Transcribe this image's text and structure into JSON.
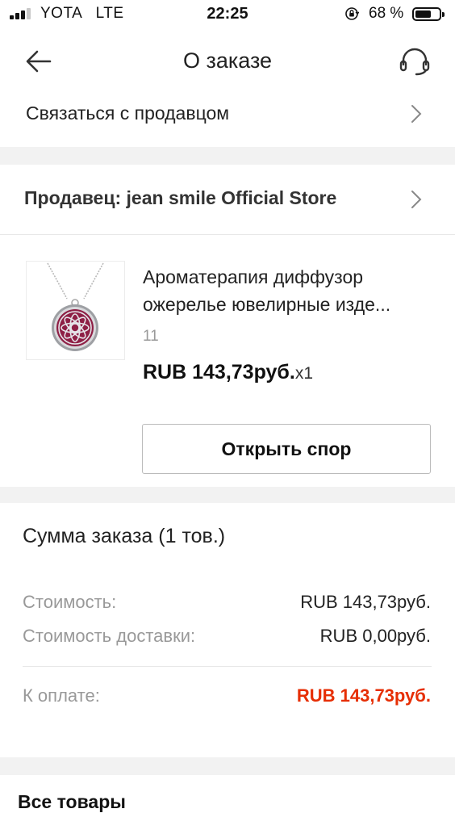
{
  "status_bar": {
    "carrier": "YOTA   LTE",
    "time": "22:25",
    "battery_percent": "68 %",
    "battery_level": 0.68,
    "icons": [
      "signal-icon",
      "orientation-lock-icon",
      "battery-icon"
    ]
  },
  "nav": {
    "title": "О заказе",
    "back_icon": "arrow-left-icon",
    "support_icon": "headset-icon"
  },
  "contact_seller": {
    "label": "Связаться с продавцом"
  },
  "seller": {
    "label": "Продавец: jean smile Official Store"
  },
  "product": {
    "name": "Ароматерапия диффузор ожерелье ювелирные изде...",
    "sku": "11",
    "price": "RUB 143,73руб.",
    "quantity": "x1"
  },
  "actions": {
    "open_dispute": "Открыть спор"
  },
  "summary": {
    "title": "Сумма заказа (1 тов.)",
    "cost_label": "Стоимость:",
    "cost_value": "RUB 143,73руб.",
    "shipping_label": "Стоимость доставки:",
    "shipping_value": "RUB 0,00руб.",
    "total_label": "К оплате:",
    "total_value": "RUB 143,73руб."
  },
  "all_items": {
    "title": "Все товары"
  },
  "colors": {
    "accent_red": "#e62e04",
    "separator": "#f2f2f2",
    "muted_text": "#999999"
  }
}
